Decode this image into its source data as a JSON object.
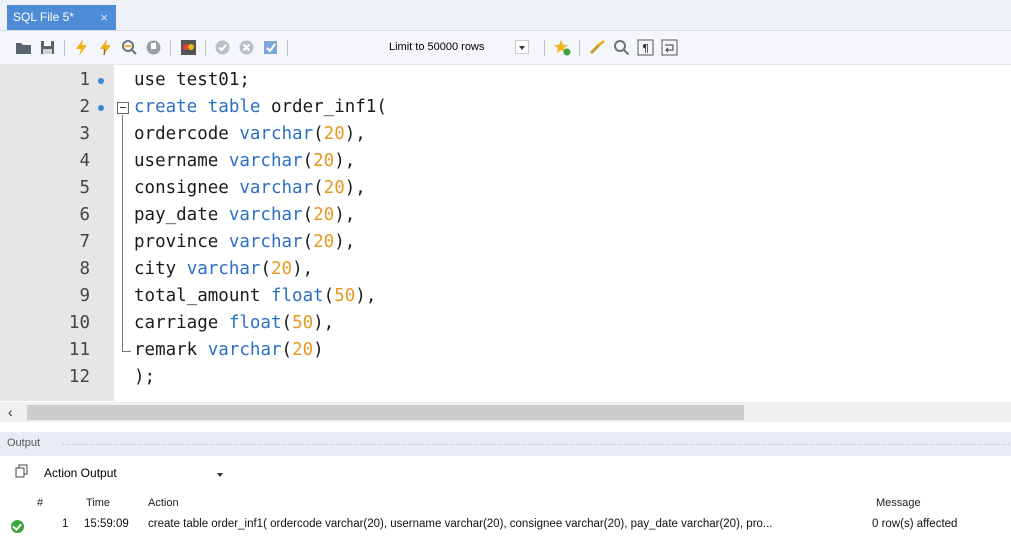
{
  "tab": {
    "title": "SQL File 5*",
    "close": "×"
  },
  "toolbar": {
    "limit_label": "Limit to 50000 rows",
    "icons": [
      "open-folder-icon",
      "save-icon",
      "execute-icon",
      "execute-statement-icon",
      "explain-icon",
      "stop-icon",
      "toggle-error-icon",
      "commit-icon",
      "rollback-icon",
      "autocommit-icon",
      "limit-select",
      "beautify-icon",
      "find-icon",
      "invisible-chars-icon",
      "wrap-icon"
    ]
  },
  "editor": {
    "lines": [
      {
        "n": "1",
        "dot": true,
        "tokens": [
          {
            "t": "use test01;",
            "c": "txt"
          }
        ]
      },
      {
        "n": "2",
        "dot": true,
        "fold": true,
        "tokens": [
          {
            "t": "create table",
            "c": "kw"
          },
          {
            "t": " order_inf1(",
            "c": "txt"
          }
        ]
      },
      {
        "n": "3",
        "tokens": [
          {
            "t": "ordercode ",
            "c": "txt"
          },
          {
            "t": "varchar",
            "c": "kw"
          },
          {
            "t": "(",
            "c": "txt"
          },
          {
            "t": "20",
            "c": "num"
          },
          {
            "t": "),",
            "c": "txt"
          }
        ]
      },
      {
        "n": "4",
        "tokens": [
          {
            "t": "username ",
            "c": "txt"
          },
          {
            "t": "varchar",
            "c": "kw"
          },
          {
            "t": "(",
            "c": "txt"
          },
          {
            "t": "20",
            "c": "num"
          },
          {
            "t": "),",
            "c": "txt"
          }
        ]
      },
      {
        "n": "5",
        "tokens": [
          {
            "t": "consignee ",
            "c": "txt"
          },
          {
            "t": "varchar",
            "c": "kw"
          },
          {
            "t": "(",
            "c": "txt"
          },
          {
            "t": "20",
            "c": "num"
          },
          {
            "t": "),",
            "c": "txt"
          }
        ]
      },
      {
        "n": "6",
        "tokens": [
          {
            "t": "pay_date ",
            "c": "txt"
          },
          {
            "t": "varchar",
            "c": "kw"
          },
          {
            "t": "(",
            "c": "txt"
          },
          {
            "t": "20",
            "c": "num"
          },
          {
            "t": "),",
            "c": "txt"
          }
        ]
      },
      {
        "n": "7",
        "tokens": [
          {
            "t": "province ",
            "c": "txt"
          },
          {
            "t": "varchar",
            "c": "kw"
          },
          {
            "t": "(",
            "c": "txt"
          },
          {
            "t": "20",
            "c": "num"
          },
          {
            "t": "),",
            "c": "txt"
          }
        ]
      },
      {
        "n": "8",
        "tokens": [
          {
            "t": "city ",
            "c": "txt"
          },
          {
            "t": "varchar",
            "c": "kw"
          },
          {
            "t": "(",
            "c": "txt"
          },
          {
            "t": "20",
            "c": "num"
          },
          {
            "t": "),",
            "c": "txt"
          }
        ]
      },
      {
        "n": "9",
        "tokens": [
          {
            "t": "total_amount ",
            "c": "txt"
          },
          {
            "t": "float",
            "c": "kw"
          },
          {
            "t": "(",
            "c": "txt"
          },
          {
            "t": "50",
            "c": "num"
          },
          {
            "t": "),",
            "c": "txt"
          }
        ]
      },
      {
        "n": "10",
        "tokens": [
          {
            "t": "carriage ",
            "c": "txt"
          },
          {
            "t": "float",
            "c": "kw"
          },
          {
            "t": "(",
            "c": "txt"
          },
          {
            "t": "50",
            "c": "num"
          },
          {
            "t": "),",
            "c": "txt"
          }
        ]
      },
      {
        "n": "11",
        "tokens": [
          {
            "t": "remark ",
            "c": "txt"
          },
          {
            "t": "varchar",
            "c": "kw"
          },
          {
            "t": "(",
            "c": "txt"
          },
          {
            "t": "20",
            "c": "num"
          },
          {
            "t": ")",
            "c": "txt"
          }
        ]
      },
      {
        "n": "12",
        "tokens": [
          {
            "t": ");",
            "c": "txt"
          }
        ]
      }
    ]
  },
  "output": {
    "title": "Output",
    "selector": "Action Output",
    "columns": {
      "num": "#",
      "time": "Time",
      "action": "Action",
      "message": "Message"
    },
    "rows": [
      {
        "num": "1",
        "time": "15:59:09",
        "action": "create table order_inf1( ordercode varchar(20), username varchar(20), consignee varchar(20), pay_date varchar(20), pro...",
        "message": "0 row(s) affected",
        "status": "success"
      }
    ]
  },
  "colors": {
    "tab_active": "#4e8dd5",
    "keyword": "#2a6fc7",
    "number": "#e79a22",
    "gutter": "#e6e6e6",
    "success": "#3aa33a"
  }
}
